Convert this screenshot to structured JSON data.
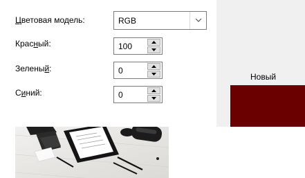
{
  "color_model": {
    "label_pre": "",
    "label_ul": "Ц",
    "label_post": "ветовая модель:",
    "value": "RGB"
  },
  "red": {
    "label_pre": "Крас",
    "label_ul": "н",
    "label_post": "ый:",
    "value": "100"
  },
  "green": {
    "label_pre": "Зелены",
    "label_ul": "й",
    "label_post": ":",
    "value": "0"
  },
  "blue": {
    "label_pre": "С",
    "label_ul": "и",
    "label_post": "ний:",
    "value": "0"
  },
  "preview": {
    "label": "Новый",
    "color": "#6b0000"
  },
  "icons": {
    "combo_arrow": "chevron-down-icon",
    "spin_up": "arrow-up-icon",
    "spin_down": "arrow-down-icon"
  }
}
